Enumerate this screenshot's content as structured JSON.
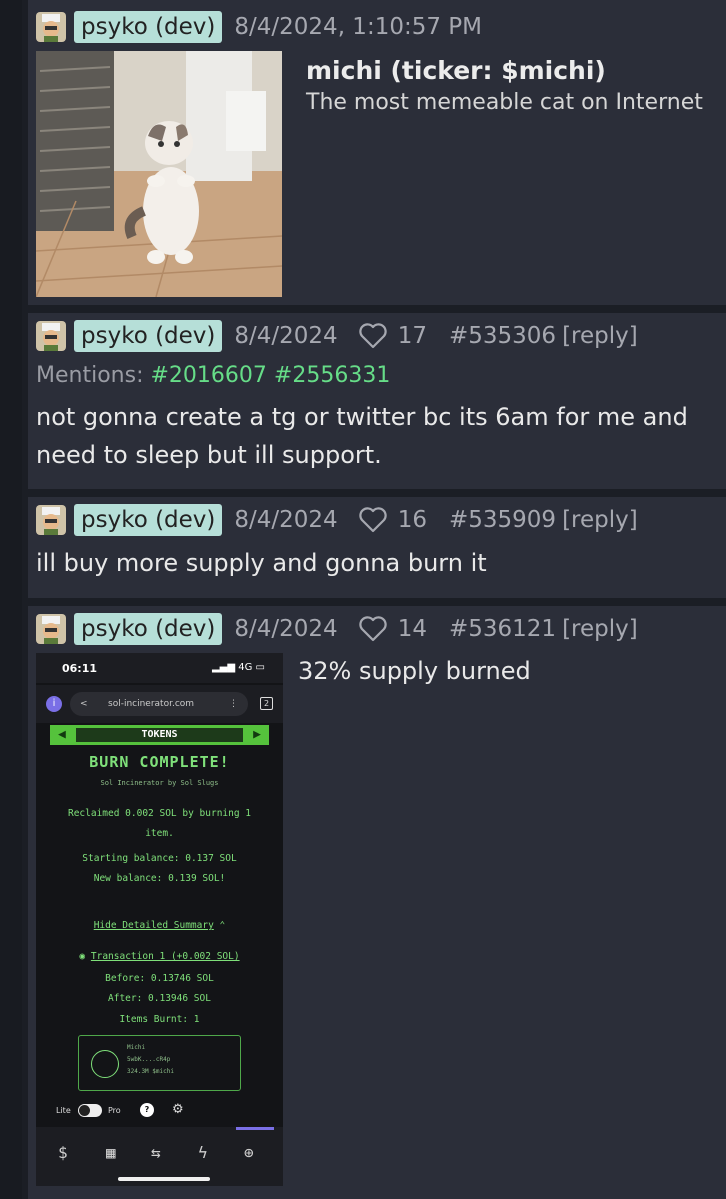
{
  "posts": [
    {
      "author": "psyko (dev)",
      "date": "8/4/2024, 1:10:57 PM",
      "token_name": "michi (ticker: $michi)",
      "token_description": "The most memeable cat on Internet"
    },
    {
      "author": "psyko (dev)",
      "date": "8/4/2024",
      "likes": "17",
      "post_id": "#535306",
      "reply": "[reply]",
      "mentions_label": "Mentions:",
      "mentions": [
        "#2016607",
        "#2556331"
      ],
      "text": "not gonna create a tg or twitter bc its 6am for me and need to sleep but ill support."
    },
    {
      "author": "psyko (dev)",
      "date": "8/4/2024",
      "likes": "16",
      "post_id": "#535909",
      "reply": "[reply]",
      "text": "ill buy more supply and gonna burn it"
    },
    {
      "author": "psyko (dev)",
      "date": "8/4/2024",
      "likes": "14",
      "post_id": "#536121",
      "reply": "[reply]",
      "text": "32% supply burned"
    }
  ],
  "phone": {
    "time": "06:11",
    "signal": "4G",
    "url_info_icon": "i",
    "back_glyph": "<",
    "url": "sol-incinerator.com",
    "menu_glyph": "⋮",
    "tab_count": "2",
    "tokens_label": "TOKENS",
    "title": "BURN COMPLETE!",
    "subtitle": "Sol Incinerator by Sol Slugs",
    "reclaimed_1": "Reclaimed 0.002 SOL by burning 1",
    "reclaimed_2": "item.",
    "starting_balance": "Starting balance: 0.137 SOL",
    "new_balance": "New balance: 0.139 SOL!",
    "hide_summary": "Hide Detailed Summary",
    "transaction": "Transaction 1 (+0.002 SOL)",
    "before": "Before: 0.13746 SOL",
    "after": "After: 0.13946 SOL",
    "items_burnt": "Items Burnt: 1",
    "item_name": "Michi",
    "item_addr": "5wbK....cR4p",
    "item_amount": "324.3M $michi",
    "lite_label": "Lite",
    "pro_label": "Pro",
    "help_glyph": "?",
    "settings_glyph": "⚙"
  }
}
